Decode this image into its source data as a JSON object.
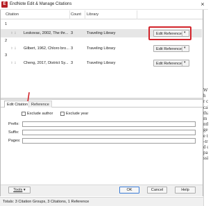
{
  "window": {
    "title": "EndNote Edit & Manage Citations",
    "close_glyph": "×",
    "accent_color": "#b51f24",
    "highlight_color": "#d2232a"
  },
  "grid": {
    "columns": [
      "Citation",
      "Count",
      "Library"
    ],
    "groups": [
      {
        "number": "1",
        "rows": [
          {
            "citation": "Leskovac, 2002, The thr...",
            "count": "3",
            "library": "Traveling Library",
            "button": "Edit Reference",
            "selected": true
          }
        ]
      },
      {
        "number": "2",
        "rows": [
          {
            "citation": "Gilbert, 1962, Chloro bro...",
            "count": "3",
            "library": "Traveling Library",
            "button": "Edit Reference",
            "selected": false
          }
        ]
      },
      {
        "number": "3",
        "rows": [
          {
            "citation": "Cheng, 2017, District Sy...",
            "count": "3",
            "library": "Traveling Library",
            "button": "Edit Reference",
            "selected": false
          }
        ]
      }
    ],
    "row_arrows": "⇧ ⇩",
    "dropdown_glyph": "▾"
  },
  "tabs": [
    "Edit Citation",
    "Reference"
  ],
  "edit_citation": {
    "exclude_author": "Exclude author",
    "exclude_year": "Exclude year",
    "prefix_label": "Prefix:",
    "suffix_label": "Suffix:",
    "pages_label": "Pages:",
    "prefix_value": "",
    "suffix_value": "",
    "pages_value": ""
  },
  "buttons": {
    "tools": "Tools",
    "ok": "OK",
    "cancel": "Cancel",
    "help": "Help"
  },
  "status": "Totals: 3 Citation Groups, 3 Citations, 1 Reference",
  "background_doc_letters": [
    "W",
    "h",
    "r c",
    "cal",
    "tha",
    "m l",
    "nth",
    "ge",
    "e tr",
    "-tr",
    "d c",
    "pa",
    "ssi"
  ]
}
